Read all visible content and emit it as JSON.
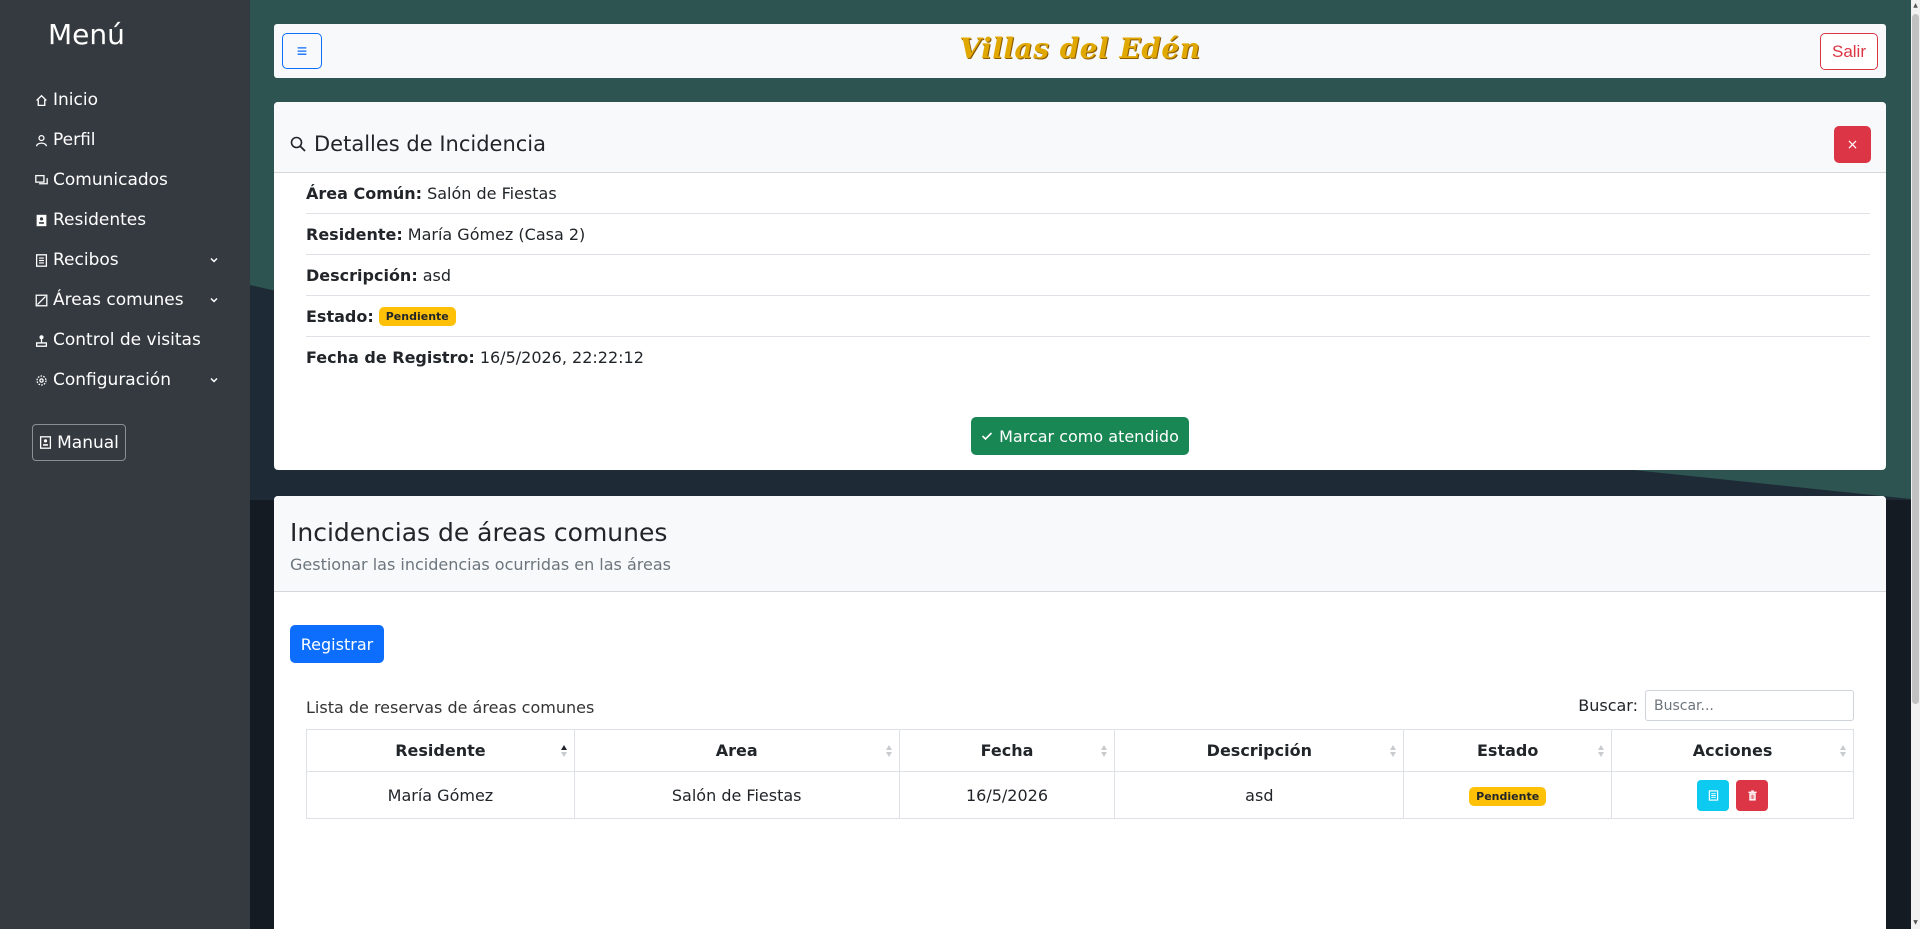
{
  "sidebar": {
    "title": "Menú",
    "items": [
      {
        "label": "Inicio",
        "icon": "home-icon",
        "has_submenu": false
      },
      {
        "label": "Perfil",
        "icon": "person-icon",
        "has_submenu": false
      },
      {
        "label": "Comunicados",
        "icon": "chat-icon",
        "has_submenu": false
      },
      {
        "label": "Residentes",
        "icon": "address-book-icon",
        "has_submenu": false
      },
      {
        "label": "Recibos",
        "icon": "receipt-icon",
        "has_submenu": true
      },
      {
        "label": "Áreas comunes",
        "icon": "area-icon",
        "has_submenu": true
      },
      {
        "label": "Control de visitas",
        "icon": "visits-icon",
        "has_submenu": false
      },
      {
        "label": "Configuración",
        "icon": "gear-icon",
        "has_submenu": true
      }
    ],
    "manual_label": "Manual"
  },
  "topbar": {
    "brand": "Villas del Edén",
    "menu_icon": "≡",
    "logout_label": "Salir"
  },
  "details": {
    "title": "Detalles de Incidencia",
    "close_label": "×",
    "area_label": "Área Común:",
    "area_value": "Salón de Fiestas",
    "resident_label": "Residente:",
    "resident_value": "María Gómez (Casa 2)",
    "description_label": "Descripción:",
    "description_value": "asd",
    "status_label": "Estado:",
    "status_value": "Pendiente",
    "date_label": "Fecha de Registro:",
    "date_value": "16/5/2026, 22:22:12",
    "attend_label": "Marcar como atendido"
  },
  "list": {
    "title": "Incidencias de áreas comunes",
    "subtitle": "Gestionar las incidencias ocurridas en las áreas",
    "register_label": "Registrar",
    "caption": "Lista de reservas de áreas comunes",
    "search_label": "Buscar:",
    "search_placeholder": "Buscar...",
    "columns": [
      "Residente",
      "Area",
      "Fecha",
      "Descripción",
      "Estado",
      "Acciones"
    ],
    "rows": [
      {
        "resident": "María Gómez",
        "area": "Salón de Fiestas",
        "date": "16/5/2026",
        "description": "asd",
        "status": "Pendiente"
      }
    ]
  },
  "colors": {
    "sidebar_bg": "#343a40",
    "primary": "#0d6efd",
    "danger": "#dc3545",
    "success": "#198754",
    "warning": "#ffc107",
    "info": "#0dcaf0",
    "brand": "#e0a800"
  }
}
